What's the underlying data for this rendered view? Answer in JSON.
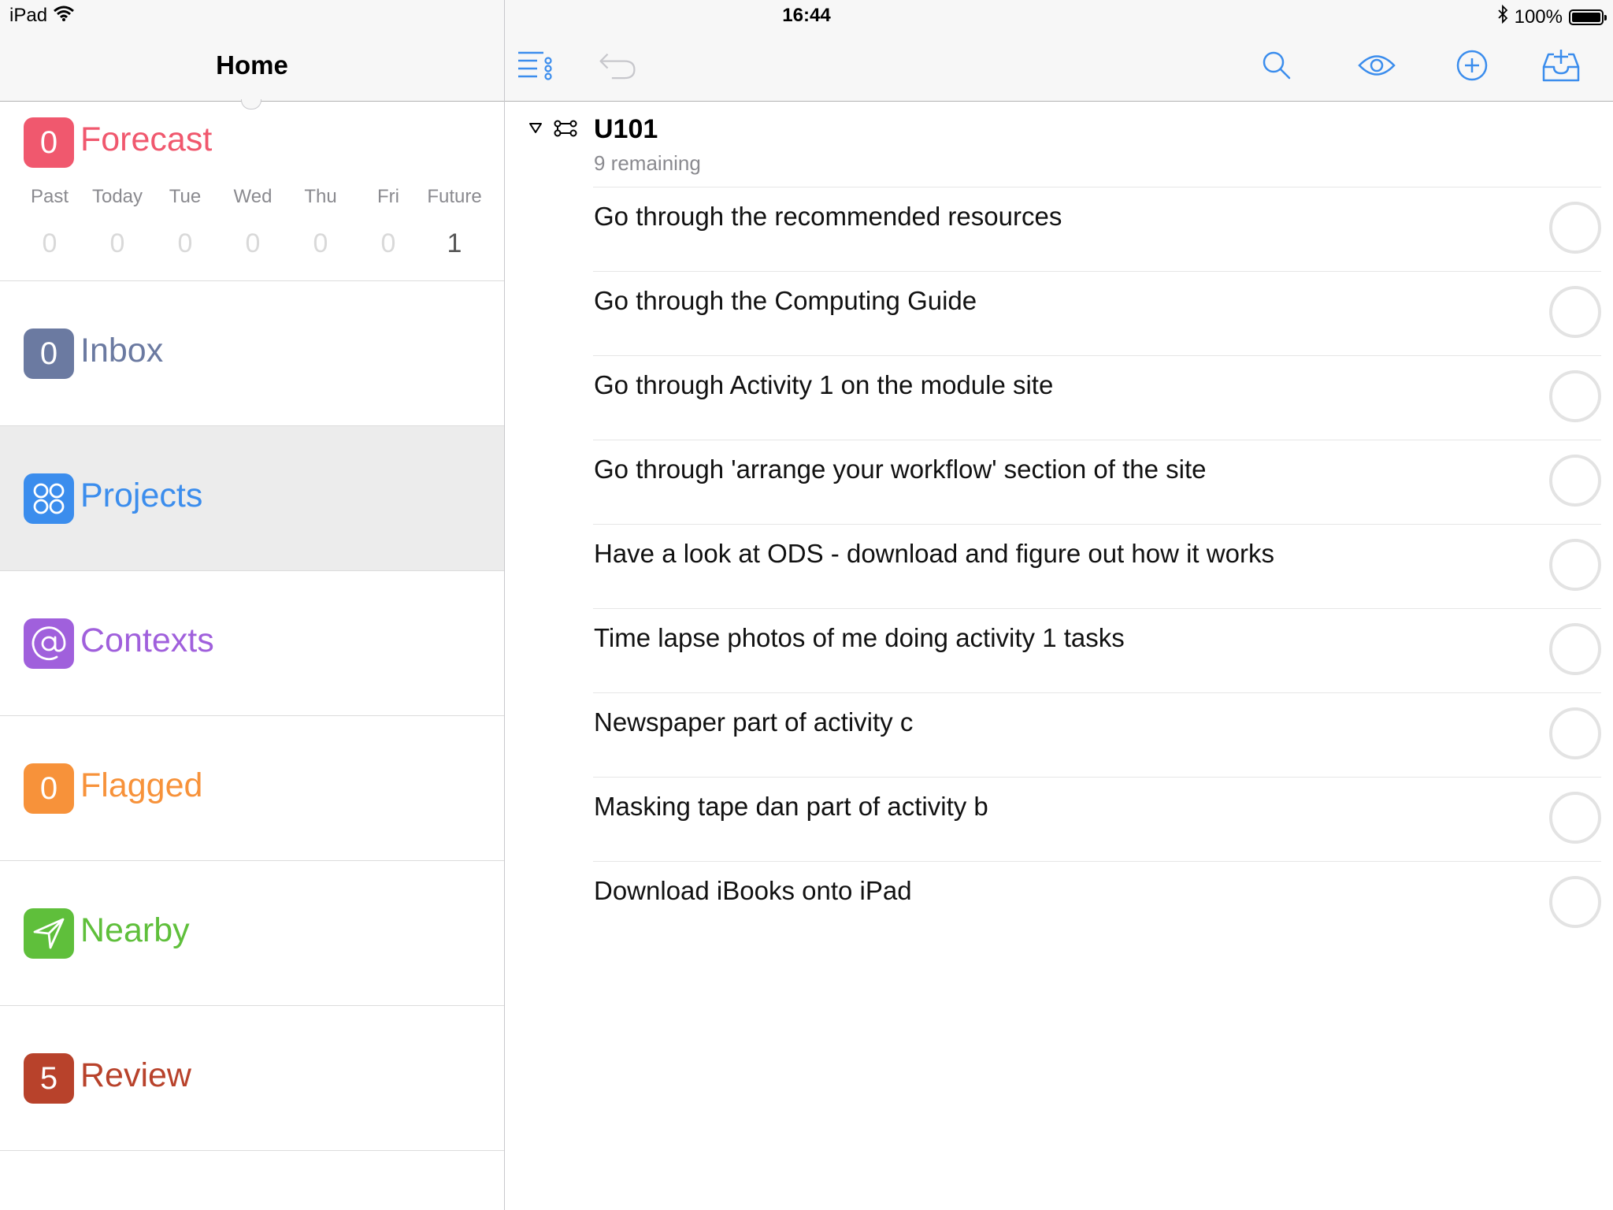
{
  "status_bar": {
    "device": "iPad",
    "time": "16:44",
    "battery": "100%"
  },
  "left_pane": {
    "title": "Home",
    "forecast": {
      "count": "0",
      "label": "Forecast",
      "color": "#f0586e",
      "days": [
        "Past",
        "Today",
        "Tue",
        "Wed",
        "Thu",
        "Fri",
        "Future"
      ],
      "counts": [
        "0",
        "0",
        "0",
        "0",
        "0",
        "0",
        "1"
      ]
    },
    "perspectives": [
      {
        "id": "inbox",
        "badge": "0",
        "label": "Inbox",
        "color": "#6b7aa1",
        "icon": "count"
      },
      {
        "id": "projects",
        "badge": "",
        "label": "Projects",
        "color": "#3b8ded",
        "icon": "projects-icon",
        "selected": true
      },
      {
        "id": "contexts",
        "badge": "",
        "label": "Contexts",
        "color": "#a060dc",
        "icon": "at-icon"
      },
      {
        "id": "flagged",
        "badge": "0",
        "label": "Flagged",
        "color": "#f7923a",
        "icon": "count"
      },
      {
        "id": "nearby",
        "badge": "",
        "label": "Nearby",
        "color": "#5fbf3b",
        "icon": "location-arrow-icon"
      },
      {
        "id": "review",
        "badge": "5",
        "label": "Review",
        "color": "#b8422b",
        "icon": "count"
      }
    ]
  },
  "toolbar": {
    "icons": [
      "list-view-icon",
      "undo-icon",
      "search-icon",
      "eye-icon",
      "add-icon",
      "inbox-add-icon"
    ],
    "accent": "#3b8ded"
  },
  "project": {
    "name": "U101",
    "remaining": "9 remaining",
    "tasks": [
      "Go through the recommended resources",
      "Go through the Computing Guide",
      "Go through Activity 1 on the module site",
      "Go through 'arrange your workflow' section of the site",
      "Have a look at ODS - download and figure out how it works",
      "Time lapse photos of me doing activity 1 tasks",
      "Newspaper part of activity c",
      "Masking tape dan part of activity b",
      "Download iBooks onto iPad"
    ]
  }
}
